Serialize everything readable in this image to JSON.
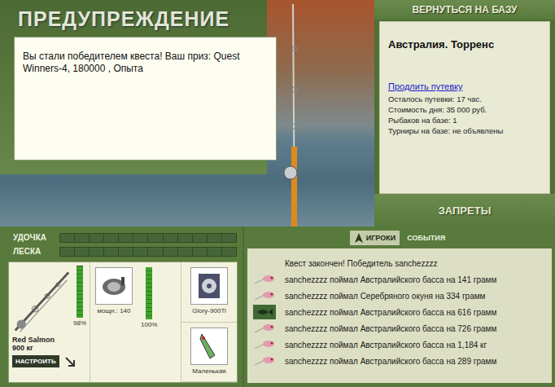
{
  "warning": {
    "title": "ПРЕДУПРЕЖДЕНИЕ",
    "message": "Вы стали победителем квеста! Ваш приз: Quest Winners-4, 180000 , Опыта"
  },
  "base": {
    "button": "ВЕРНУТЬСЯ НА БАЗУ",
    "location": "Австралия. Торренс",
    "extend_link": "Продлить путевку",
    "lines": [
      "Осталось путевки: 17 час.",
      "Стоимость дня: 35 000 руб.",
      "Рыбаков на базе: 1",
      "Турниры на базе: не объявлены"
    ],
    "bans_button": "ЗАПРЕТЫ"
  },
  "gauges": [
    {
      "label": "УДОЧКА",
      "level": 0
    },
    {
      "label": "ЛЕСКА",
      "level": 0
    }
  ],
  "tackle": {
    "rod": {
      "name": "Red Salmon",
      "load": "900 кг",
      "reading": "98%",
      "level": 0.98
    },
    "reel": {
      "power": "мощн.: 140",
      "reading": "100%",
      "level": 1
    },
    "line": {
      "name": "Glory-900Ti"
    },
    "lure": {
      "name": "Маленькая"
    },
    "setup_button": "НАСТРОИТЬ"
  },
  "tabs": [
    {
      "label": "ИГРОКИ",
      "selected": true
    },
    {
      "label": "СОБЫТИЯ",
      "selected": false
    }
  ],
  "events": [
    {
      "text": "Квест закончен! Победитель sanchezzzz",
      "kind": "notice"
    },
    {
      "text": "sanchezzzz поймал Австралийского басса на 141 грамм",
      "kind": "lure"
    },
    {
      "text": "sanchezzzz поймал Серебряного окуня на 334 грамм",
      "kind": "lure"
    },
    {
      "text": "sanchezzzz поймал Австралийского басса на 616 грамм",
      "kind": "fish"
    },
    {
      "text": "sanchezzzz поймал Австралийского басса на 726 грамм",
      "kind": "lure"
    },
    {
      "text": "sanchezzzz поймал Австралийского басса на 1,184 кг",
      "kind": "lure"
    },
    {
      "text": "sanchezzzz поймал Австралийского басса на 289 грамм",
      "kind": "lure"
    }
  ]
}
